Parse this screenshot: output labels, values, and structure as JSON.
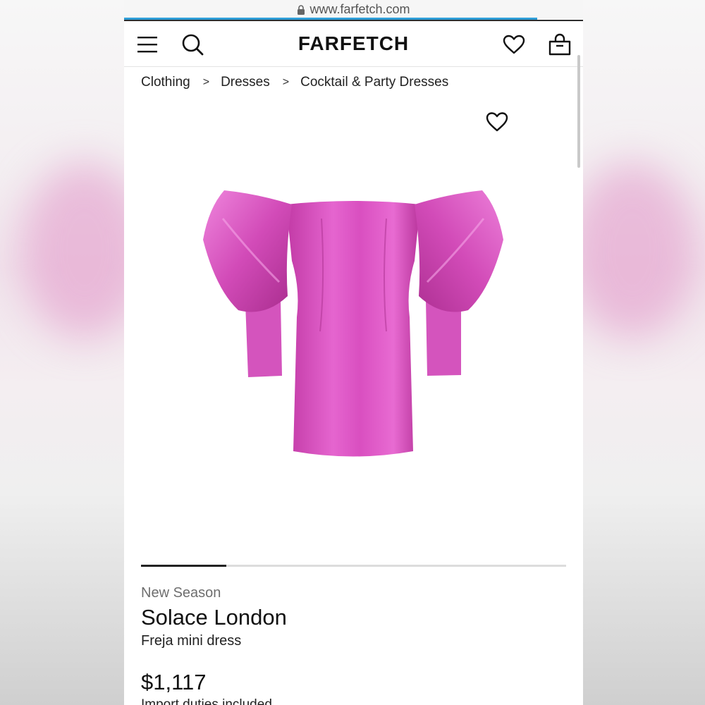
{
  "browser": {
    "url": "www.farfetch.com"
  },
  "header": {
    "logo": "FARFETCH",
    "icons": [
      "menu-icon",
      "search-icon",
      "heart-icon",
      "shopping-bag-icon"
    ]
  },
  "breadcrumb": [
    "Clothing",
    "Dresses",
    "Cocktail & Party Dresses"
  ],
  "breadcrumb_separator": ">",
  "gallery": {
    "current_fraction": 0.2
  },
  "product": {
    "badge": "New Season",
    "brand": "Solace London",
    "name": "Freja mini dress",
    "price": "$1,117",
    "duties_note": "Import duties included",
    "color_hex": "#d94fc0"
  },
  "colors": {
    "accent_loadbar": "#2f9ed8",
    "text": "#111111",
    "muted": "#6e6e6e"
  }
}
